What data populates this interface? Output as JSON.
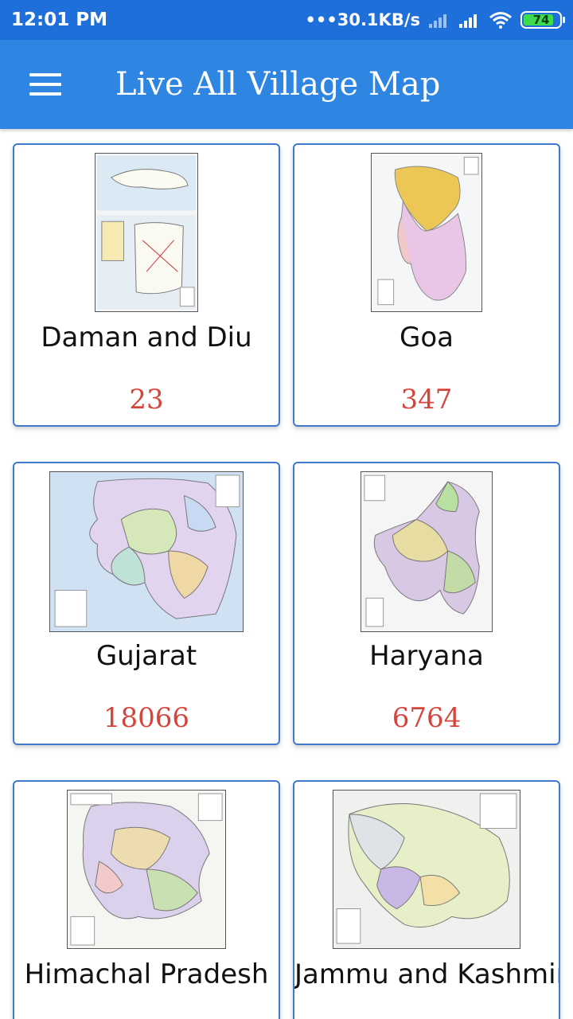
{
  "status_bar": {
    "time": "12:01 PM",
    "network_speed": "•••30.1KB/s",
    "battery": "74"
  },
  "app_bar": {
    "title": "Live All Village Map"
  },
  "states": [
    {
      "name": "Daman and Diu",
      "count": "23"
    },
    {
      "name": "Goa",
      "count": "347"
    },
    {
      "name": "Gujarat",
      "count": "18066"
    },
    {
      "name": "Haryana",
      "count": "6764"
    },
    {
      "name": "Himachal Pradesh",
      "count": ""
    },
    {
      "name": "Jammu and Kashmir",
      "count": ""
    }
  ],
  "colors": {
    "status_bar": "#1e6fd9",
    "app_bar": "#2f85e2",
    "card_border": "#3f7ad0",
    "count_text": "#d6453b"
  }
}
